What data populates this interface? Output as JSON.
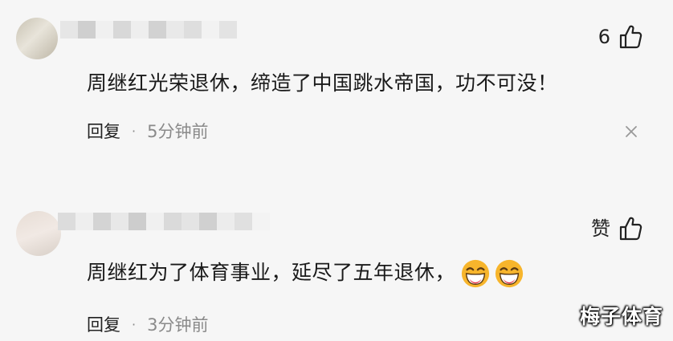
{
  "comments": [
    {
      "like_count": "6",
      "text": "周继红光荣退休，缔造了中国跳水帝国，功不可没！",
      "reply_label": "回复",
      "separator": "·",
      "time": "5分钟前",
      "close_icon": "close-icon",
      "username_blur_colors": [
        "#e6e6e6",
        "#cfcfcf",
        "#f0f0f0",
        "#d8d8d8",
        "#eeeeee",
        "#d2d2d2",
        "#e9e9e9",
        "#dedede",
        "#f2f2f2",
        "#e3e3e3"
      ]
    },
    {
      "like_count": "赞",
      "text": "周继红为了体育事业，延尽了五年退休，",
      "emoji": [
        "laughing-emoji",
        "laughing-emoji"
      ],
      "reply_label": "回复",
      "separator": "·",
      "time": "3分钟前",
      "username_blur_colors": [
        "#dcdcdc",
        "#eeeeee",
        "#d4d4d4",
        "#e8e8e8",
        "#cdcdcd",
        "#f0f0f0",
        "#dadada",
        "#e4e4e4",
        "#d0d0d0",
        "#ececec",
        "#e0e0e0",
        "#f3f3f3"
      ]
    }
  ],
  "watermark": "梅子体育",
  "colors": {
    "background": "#f6f6f6",
    "text": "#1a1a1a",
    "meta": "#8a8a8a"
  }
}
